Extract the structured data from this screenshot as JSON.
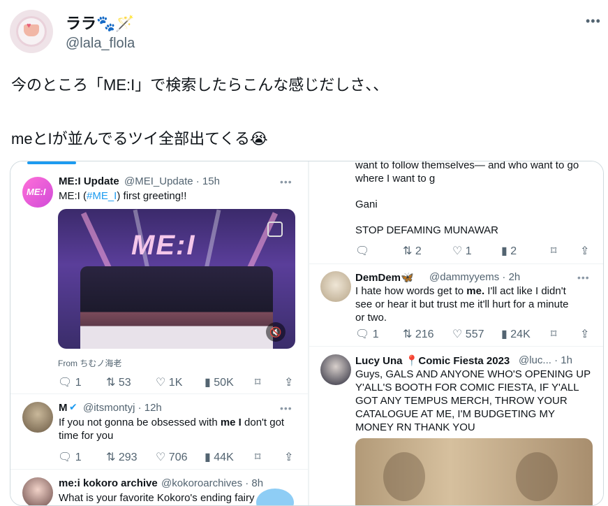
{
  "author": {
    "display_name": "ララ🐾🪄",
    "handle": "@lala_flola"
  },
  "more_label": "•••",
  "tweet": {
    "line1": "今のところ「ME:I」で検索したらこんな感じだしさ、、",
    "line2": "meとIが並んでるツイ全部出てくる😭"
  },
  "embed": {
    "left": [
      {
        "name": "ME:I Update",
        "handle": "@MEI_Update · 15h",
        "text_prefix": "ME:I (",
        "hashtag": "#ME_I",
        "text_suffix": ") first greeting!!",
        "media_logo": "ME:I",
        "from": "From ちむノ海老",
        "stats": [
          "1",
          "53",
          "1K",
          "50K"
        ]
      },
      {
        "name": "M",
        "handle": "@itsmontyj · 12h",
        "line1_a": "If you not gonna be obsessed with ",
        "line1_b": "me I",
        "line1_c": " don't got",
        "line2": "time for you",
        "stats": [
          "1",
          "293",
          "706",
          "44K"
        ]
      },
      {
        "name": "me:i kokoro archive",
        "handle": "@kokoroarchives · 8h",
        "line1": "What is your favorite Kokoro's ending fairy"
      }
    ],
    "right": [
      {
        "line0": "want to follow themselves— and who want to go",
        "line1": "where I want to g",
        "line2": "Gani",
        "line3": "STOP DEFAMING MUNAWAR",
        "stats": [
          "",
          "2",
          "1",
          "2"
        ]
      },
      {
        "name": "DemDem🦋",
        "handle": "@dammyyems · 2h",
        "line1_a": "I hate how words get to ",
        "line1_b": "me.",
        "line1_c": " I'll act like I didn't",
        "line2": "see or hear it but trust me it'll hurt for a minute",
        "line3": "or two.",
        "stats": [
          "1",
          "216",
          "557",
          "24K"
        ]
      },
      {
        "name": "Lucy Una 📍Comic Fiesta 2023",
        "handle": "@luc... · 1h",
        "lines": [
          "Guys, GALS AND ANYONE WHO'S OPENING UP",
          "Y'ALL'S BOOTH FOR COMIC FIESTA, IF Y'ALL",
          "GOT ANY TEMPUS MERCH, THROW YOUR",
          "CATALOGUE AT ME, I'M BUDGETING MY",
          "MONEY RN THANK YOU"
        ]
      }
    ]
  },
  "icons": {
    "reply": "🗨",
    "retweet": "⇅",
    "like": "♡",
    "views": "📊",
    "bookmark": "🔖",
    "share": "⇪"
  }
}
